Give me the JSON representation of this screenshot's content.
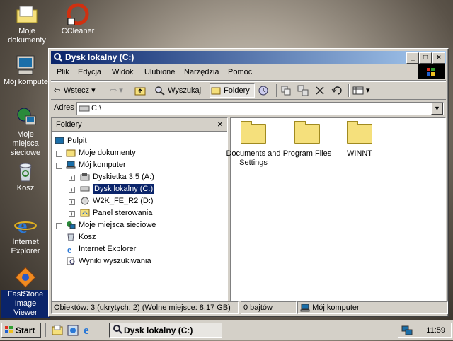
{
  "desktop": {
    "icons": [
      {
        "label": "Moje dokumenty"
      },
      {
        "label": "CCleaner"
      },
      {
        "label": "Mój komputer"
      },
      {
        "label": "Moje miejsca sieciowe"
      },
      {
        "label": "Kosz"
      },
      {
        "label": "Internet Explorer"
      },
      {
        "label": "FastStone Image Viewer"
      }
    ]
  },
  "window": {
    "title": "Dysk lokalny (C:)",
    "menu": [
      "Plik",
      "Edycja",
      "Widok",
      "Ulubione",
      "Narzędzia",
      "Pomoc"
    ],
    "toolbar": {
      "back": "Wstecz",
      "search": "Wyszukaj",
      "folders": "Foldery"
    },
    "address": {
      "label": "Adres",
      "value": "C:\\"
    },
    "folders_pane": {
      "title": "Foldery",
      "tree": [
        {
          "label": "Pulpit"
        },
        {
          "label": "Moje dokumenty"
        },
        {
          "label": "Mój komputer"
        },
        {
          "label": "Dyskietka 3,5 (A:)"
        },
        {
          "label": "Dysk lokalny (C:)"
        },
        {
          "label": "W2K_FE_R2 (D:)"
        },
        {
          "label": "Panel sterowania"
        },
        {
          "label": "Moje miejsca sieciowe"
        },
        {
          "label": "Kosz"
        },
        {
          "label": "Internet Explorer"
        },
        {
          "label": "Wyniki wyszukiwania"
        }
      ]
    },
    "files": [
      {
        "name": "Documents and Settings"
      },
      {
        "name": "Program Files"
      },
      {
        "name": "WINNT"
      }
    ],
    "status": {
      "objects": "Obiektów: 3 (ukrytych: 2) (Wolne miejsce: 8,17 GB)",
      "size": "0 bajtów",
      "location": "Mój komputer"
    }
  },
  "taskbar": {
    "start": "Start",
    "task": "Dysk lokalny (C:)",
    "clock": "11:59"
  }
}
